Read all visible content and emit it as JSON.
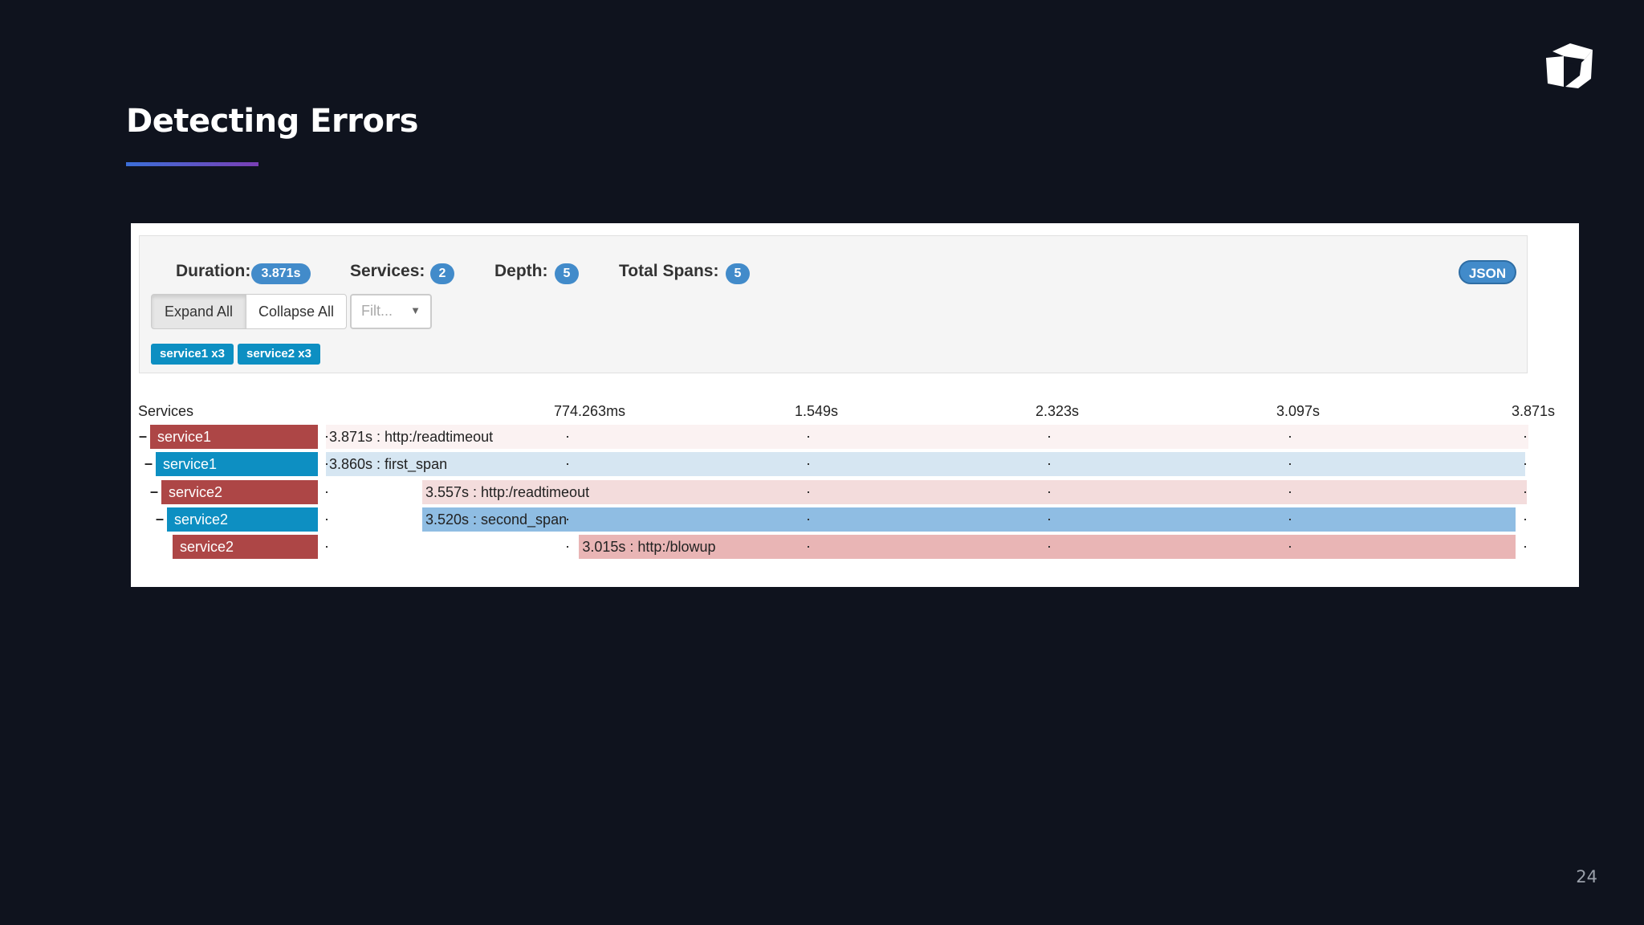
{
  "slide": {
    "title": "Detecting Errors",
    "page_number": "24"
  },
  "trace": {
    "duration_label": "Duration:",
    "duration_value": "3.871s",
    "services_label": "Services:",
    "services_value": "2",
    "depth_label": "Depth:",
    "depth_value": "5",
    "total_spans_label": "Total Spans:",
    "total_spans_value": "5",
    "json_button": "JSON",
    "expand_all": "Expand All",
    "collapse_all": "Collapse All",
    "filter_placeholder": "Filt...",
    "service_tags": [
      "service1 x3",
      "service2 x3"
    ]
  },
  "timeline": {
    "services_header": "Services",
    "ticks": [
      "774.263ms",
      "1.549s",
      "2.323s",
      "3.097s",
      "3.871s"
    ],
    "rows": [
      {
        "toggle": "–",
        "service": "service1",
        "label": "3.871s : http:/readtimeout",
        "start_s": 0.0,
        "end_s": 3.871,
        "color": "#ad4646",
        "bar_color": "#fbf2f2"
      },
      {
        "toggle": "–",
        "service": "service1",
        "label": "3.860s : first_span",
        "start_s": 0.0,
        "end_s": 3.86,
        "color": "#0d8fc2",
        "bar_color": "#d6e6f2"
      },
      {
        "toggle": "–",
        "service": "service2",
        "label": "3.557s : http:/readtimeout",
        "start_s": 0.31,
        "end_s": 3.867,
        "color": "#ad4646",
        "bar_color": "#f3dcdc"
      },
      {
        "toggle": "–",
        "service": "service2",
        "label": "3.520s : second_span",
        "start_s": 0.31,
        "end_s": 3.83,
        "color": "#0d8fc2",
        "bar_color": "#8fbde3"
      },
      {
        "toggle": "",
        "service": "service2",
        "label": "3.015s : http:/blowup",
        "start_s": 0.815,
        "end_s": 3.83,
        "color": "#ad4646",
        "bar_color": "#e9b5b5"
      }
    ]
  }
}
